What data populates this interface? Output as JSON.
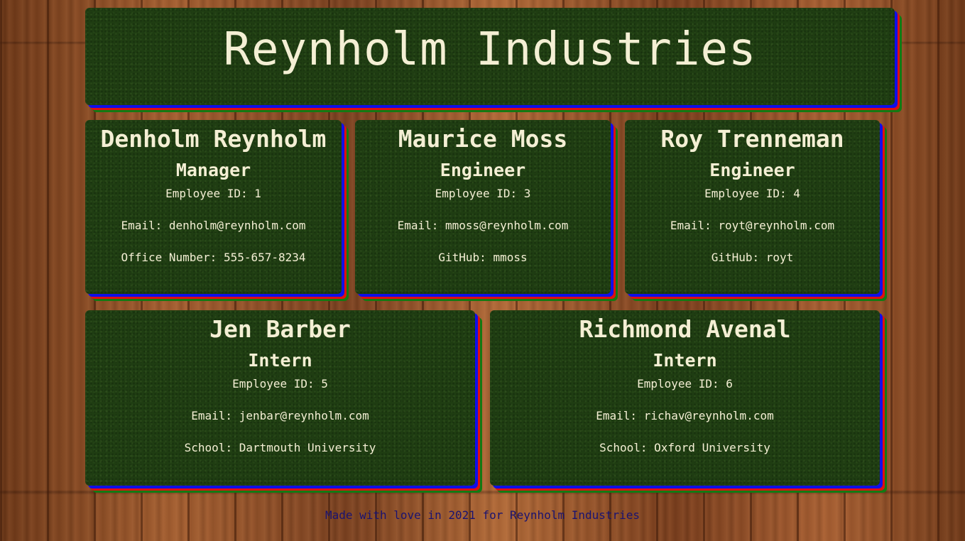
{
  "header": {
    "title": "Reynholm Industries"
  },
  "employees": [
    {
      "name": "Denholm Reynholm",
      "role": "Manager",
      "details": [
        "Employee ID: 1",
        "Email: denholm@reynholm.com",
        "Office Number: 555-657-8234"
      ]
    },
    {
      "name": "Maurice Moss",
      "role": "Engineer",
      "details": [
        "Employee ID: 3",
        "Email: mmoss@reynholm.com",
        "GitHub: mmoss"
      ]
    },
    {
      "name": "Roy Trenneman",
      "role": "Engineer",
      "details": [
        "Employee ID: 4",
        "Email: royt@reynholm.com",
        "GitHub: royt"
      ]
    },
    {
      "name": "Jen Barber",
      "role": "Intern",
      "details": [
        "Employee ID: 5",
        "Email: jenbar@reynholm.com",
        "School: Dartmouth University"
      ]
    },
    {
      "name": "Richmond Avenal",
      "role": "Intern",
      "details": [
        "Employee ID: 6",
        "Email: richav@reynholm.com",
        "School: Oxford University"
      ]
    }
  ],
  "footer": {
    "text": "Made with love in 2021 for Reynholm Industries"
  },
  "colors": {
    "board_green": "#1f3d12",
    "text_cream": "#f4efd4",
    "shadow_blue": "#1010e8",
    "shadow_red": "#e01010",
    "shadow_green": "#137a13",
    "footer_text": "#1a1370",
    "wood": "#8a4a24"
  }
}
